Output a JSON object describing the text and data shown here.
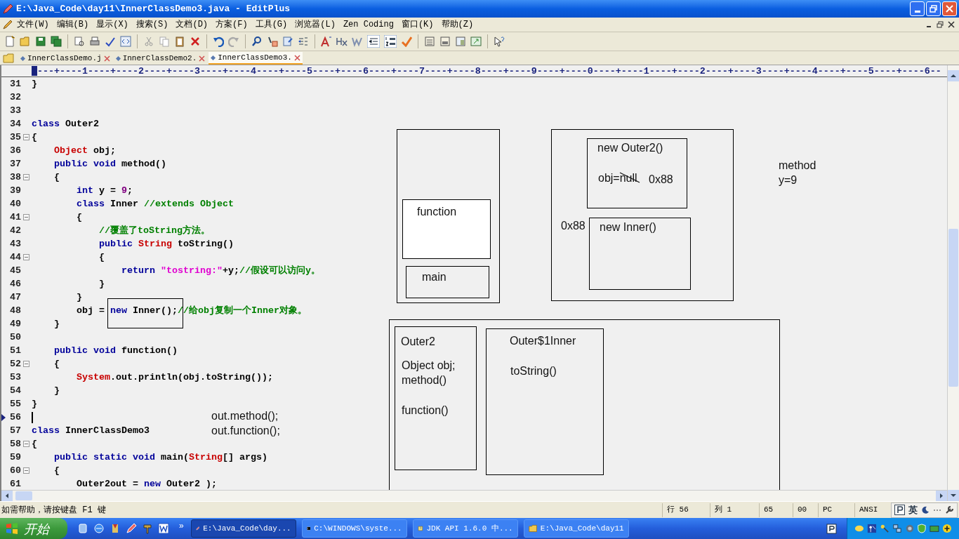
{
  "window": {
    "title": "E:\\Java_Code\\day11\\InnerClassDemo3.java - EditPlus"
  },
  "menu": [
    "文件(W)",
    "编辑(B)",
    "显示(X)",
    "搜索(S)",
    "文档(D)",
    "方案(F)",
    "工具(G)",
    "浏览器(L)",
    "Zen Coding",
    "窗口(K)",
    "帮助(Z)"
  ],
  "tabs": [
    {
      "label": "InnerClassDemo.j",
      "selected": false
    },
    {
      "label": "InnerClassDemo2.",
      "selected": false
    },
    {
      "label": "InnerClassDemo3.",
      "selected": true
    }
  ],
  "ruler": "---+----1----+----2----+----3----+----4----+----5----+----6----+----7----+----8----+----9----+----0----+----1----+----2----+----3----+----4----+----5----+----6--",
  "lines": [
    {
      "number": "31",
      "fold": false,
      "current": false,
      "tokens": [
        {
          "kind": "plain",
          "text": "}"
        }
      ]
    },
    {
      "number": "32",
      "fold": false,
      "current": false
    },
    {
      "number": "33",
      "fold": false,
      "current": false
    },
    {
      "number": "34",
      "fold": false,
      "current": false,
      "tokens": [
        {
          "kind": "keyword",
          "text": "class"
        },
        {
          "kind": "plain",
          "text": " Outer2"
        }
      ]
    },
    {
      "number": "35",
      "fold": true,
      "current": false,
      "tokens": [
        {
          "kind": "plain",
          "text": "{"
        }
      ]
    },
    {
      "number": "36",
      "fold": false,
      "current": false,
      "tokens": [
        {
          "kind": "type",
          "text": "    Object"
        },
        {
          "kind": "plain",
          "text": " obj;"
        }
      ]
    },
    {
      "number": "37",
      "fold": false,
      "current": false,
      "tokens": [
        {
          "kind": "keyword",
          "text": "    public void"
        },
        {
          "kind": "plain",
          "text": " method()"
        }
      ]
    },
    {
      "number": "38",
      "fold": true,
      "current": false,
      "tokens": [
        {
          "kind": "plain",
          "text": "    {"
        }
      ]
    },
    {
      "number": "39",
      "fold": false,
      "current": false,
      "tokens": [
        {
          "kind": "keyword",
          "text": "        int"
        },
        {
          "kind": "plain",
          "text": " y = "
        },
        {
          "kind": "number",
          "text": "9"
        },
        {
          "kind": "plain",
          "text": ";"
        }
      ]
    },
    {
      "number": "40",
      "fold": false,
      "current": false,
      "tokens": [
        {
          "kind": "keyword",
          "text": "        class"
        },
        {
          "kind": "plain",
          "text": " Inner "
        },
        {
          "kind": "comment",
          "text": "//extends Object"
        }
      ]
    },
    {
      "number": "41",
      "fold": true,
      "current": false,
      "tokens": [
        {
          "kind": "plain",
          "text": "        {"
        }
      ]
    },
    {
      "number": "42",
      "fold": false,
      "current": false,
      "tokens": [
        {
          "kind": "comment",
          "text": "            //覆盖了toString方法。"
        }
      ]
    },
    {
      "number": "43",
      "fold": false,
      "current": false,
      "tokens": [
        {
          "kind": "keyword",
          "text": "            public"
        },
        {
          "kind": "type",
          "text": " String"
        },
        {
          "kind": "plain",
          "text": " toString()"
        }
      ]
    },
    {
      "number": "44",
      "fold": true,
      "current": false,
      "tokens": [
        {
          "kind": "plain",
          "text": "            {"
        }
      ]
    },
    {
      "number": "45",
      "fold": false,
      "current": false,
      "tokens": [
        {
          "kind": "keyword",
          "text": "                return"
        },
        {
          "kind": "string",
          "text": " \"tostring:\""
        },
        {
          "kind": "plain",
          "text": "+y;"
        },
        {
          "kind": "comment",
          "text": "//假设可以访问y。"
        }
      ]
    },
    {
      "number": "46",
      "fold": false,
      "current": false,
      "tokens": [
        {
          "kind": "plain",
          "text": "            }"
        }
      ]
    },
    {
      "number": "47",
      "fold": false,
      "current": false,
      "tokens": [
        {
          "kind": "plain",
          "text": "        }"
        }
      ]
    },
    {
      "number": "48",
      "fold": false,
      "current": false,
      "tokens": [
        {
          "kind": "plain",
          "text": "        obj = "
        },
        {
          "kind": "keyword",
          "text": "new"
        },
        {
          "kind": "plain",
          "text": " Inner();"
        },
        {
          "kind": "comment",
          "text": "//给obj复制一个Inner对象。"
        }
      ]
    },
    {
      "number": "49",
      "fold": false,
      "current": false,
      "tokens": [
        {
          "kind": "plain",
          "text": "    }"
        }
      ]
    },
    {
      "number": "50",
      "fold": false,
      "current": false
    },
    {
      "number": "51",
      "fold": false,
      "current": false,
      "tokens": [
        {
          "kind": "keyword",
          "text": "    public void"
        },
        {
          "kind": "plain",
          "text": " function()"
        }
      ]
    },
    {
      "number": "52",
      "fold": true,
      "current": false,
      "tokens": [
        {
          "kind": "plain",
          "text": "    {"
        }
      ]
    },
    {
      "number": "53",
      "fold": false,
      "current": false,
      "tokens": [
        {
          "kind": "type",
          "text": "        System"
        },
        {
          "kind": "plain",
          "text": ".out.println(obj.toString());"
        }
      ]
    },
    {
      "number": "54",
      "fold": false,
      "current": false,
      "tokens": [
        {
          "kind": "plain",
          "text": "    }"
        }
      ]
    },
    {
      "number": "55",
      "fold": false,
      "current": false,
      "tokens": [
        {
          "kind": "plain",
          "text": "}"
        }
      ]
    },
    {
      "number": "56",
      "fold": false,
      "current": true
    },
    {
      "number": "57",
      "fold": false,
      "current": false,
      "tokens": [
        {
          "kind": "keyword",
          "text": "class"
        },
        {
          "kind": "plain",
          "text": " InnerClassDemo3"
        }
      ]
    },
    {
      "number": "58",
      "fold": true,
      "current": false,
      "tokens": [
        {
          "kind": "plain",
          "text": "{"
        }
      ]
    },
    {
      "number": "59",
      "fold": false,
      "current": false,
      "tokens": [
        {
          "kind": "keyword",
          "text": "    public static void"
        },
        {
          "kind": "plain",
          "text": " main("
        },
        {
          "kind": "type",
          "text": "String"
        },
        {
          "kind": "plain",
          "text": "[] args)"
        }
      ]
    },
    {
      "number": "60",
      "fold": true,
      "current": false,
      "tokens": [
        {
          "kind": "plain",
          "text": "    {"
        }
      ]
    },
    {
      "number": "61",
      "fold": false,
      "current": false,
      "tokens": [
        {
          "kind": "plain",
          "text": "        Outer2out = "
        },
        {
          "kind": "keyword",
          "text": "new"
        },
        {
          "kind": "plain",
          "text": " Outer2 );"
        }
      ]
    }
  ],
  "sketch": [
    {
      "kind": "box",
      "filled": false
    },
    {
      "kind": "box",
      "label": "function",
      "filled": true
    },
    {
      "kind": "box",
      "label": "main",
      "filled": false
    },
    {
      "kind": "box",
      "filled": false
    },
    {
      "kind": "box",
      "label": "new Outer2()",
      "filled": false
    },
    {
      "kind": "text",
      "lines": [
        "obj=null"
      ],
      "crossed_out": true
    },
    {
      "kind": "text",
      "lines": [
        "0x88"
      ],
      "crossed_out": false
    },
    {
      "kind": "text",
      "lines": [
        "0x88"
      ],
      "crossed_out": false
    },
    {
      "kind": "box",
      "label": "new Inner()",
      "filled": false
    },
    {
      "kind": "text",
      "lines": [
        "method",
        "y=9"
      ],
      "crossed_out": false
    },
    {
      "kind": "box",
      "filled": false
    },
    {
      "kind": "box",
      "label": "Outer2",
      "filled": false
    },
    {
      "kind": "text",
      "lines": [
        "Object obj;",
        "method()"
      ],
      "crossed_out": false
    },
    {
      "kind": "text",
      "lines": [
        "function()"
      ],
      "crossed_out": false
    },
    {
      "kind": "box",
      "label": "Outer$1Inner",
      "filled": false
    },
    {
      "kind": "text",
      "lines": [
        "toString()"
      ],
      "crossed_out": false
    },
    {
      "kind": "box",
      "filled": false
    },
    {
      "kind": "text",
      "lines": [
        "out.method();",
        "out.function();"
      ],
      "crossed_out": false
    }
  ],
  "status_bar": {
    "hint": "如需帮助，请按键盘 F1 键",
    "cells": [
      "行 56",
      "列 1",
      "65",
      "00",
      "PC",
      "ANSI"
    ],
    "ime": "英"
  },
  "taskbar": {
    "start": "开始",
    "more": "»",
    "tasks": [
      {
        "label": "E:\\Java_Code\\day...",
        "selected": true
      },
      {
        "label": "C:\\WINDOWS\\syste...",
        "selected": false
      },
      {
        "label": "JDK API 1.6.0 中...",
        "selected": false
      },
      {
        "label": "E:\\Java_Code\\day11",
        "selected": false
      }
    ]
  }
}
